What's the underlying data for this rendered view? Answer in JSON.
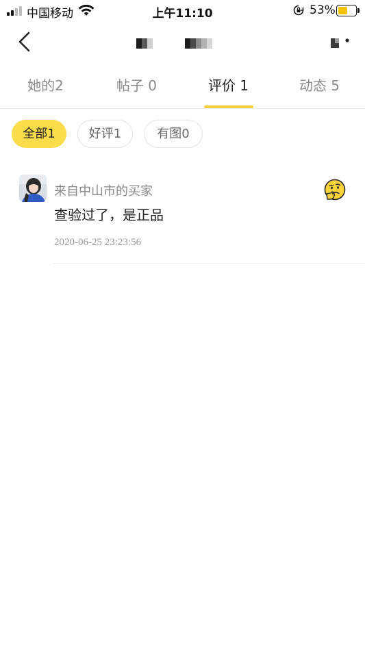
{
  "status_bar": {
    "carrier": "中国移动",
    "time": "上午11:10",
    "battery_percent": "53%",
    "battery_level": 0.53,
    "icons": [
      "signal-icon",
      "wifi-icon",
      "orientation-lock-icon",
      "battery-icon"
    ]
  },
  "nav": {
    "back_icon": "chevron-left-icon",
    "title": "",
    "more_icon": "more-icon"
  },
  "tabs": [
    {
      "label": "她的2",
      "active": false
    },
    {
      "label": "帖子 0",
      "active": false
    },
    {
      "label": "评价 1",
      "active": true
    },
    {
      "label": "动态 5",
      "active": false
    }
  ],
  "filters": [
    {
      "label": "全部1",
      "active": true
    },
    {
      "label": "好评1",
      "active": false
    },
    {
      "label": "有图0",
      "active": false
    }
  ],
  "reviews": [
    {
      "buyer": "来自中山市的买家",
      "content": "查验过了，是正品",
      "date": "2020-06-25 23:23:56",
      "rating_icon": "thinking-face-emoji-icon"
    }
  ],
  "colors": {
    "accent": "#f7cf3b",
    "chip_active": "#fbdc4a",
    "battery": "#f5c400",
    "text_primary": "#222222",
    "text_secondary": "#8a8a8a"
  }
}
